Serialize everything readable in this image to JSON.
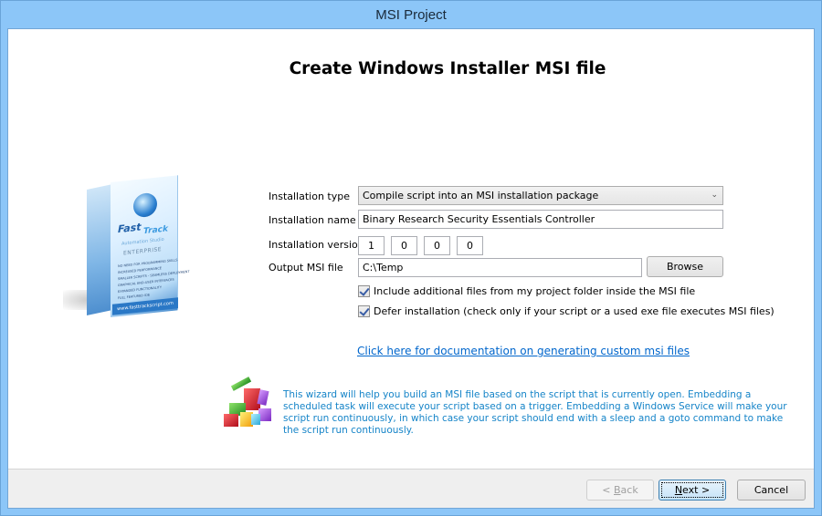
{
  "window": {
    "title": "MSI Project"
  },
  "heading": "Create Windows Installer MSI file",
  "product_box": {
    "brand": "Fast",
    "brand2": "Track",
    "subtitle": "Automation Studio",
    "edition": "ENTERPRISE",
    "spine": "FastTrack",
    "bullets": [
      "NO NEED FOR PROGRAMMING SKILLS",
      "INCREASED PERFORMANCE",
      "SMALLER SCRIPTS - SEAMLESS DEPLOYMENT",
      "GRAPHICAL END-USER INTERFACES",
      "EXPANDED FUNCTIONALITY",
      "FULL FEATURED IDE"
    ],
    "url": "www.fasttrackscript.com"
  },
  "form": {
    "installation_type": {
      "label": "Installation type",
      "value": "Compile script into an MSI installation package"
    },
    "installation_name": {
      "label": "Installation name",
      "value": "Binary Research Security Essentials Controller"
    },
    "installation_version": {
      "label": "Installation version",
      "parts": [
        "1",
        "0",
        "0",
        "0"
      ]
    },
    "output_msi_file": {
      "label": "Output MSI file",
      "value": "C:\\Temp",
      "browse_label": "Browse"
    },
    "include_files": {
      "label": "Include additional files from my project folder inside the MSI file",
      "checked": true
    },
    "defer_installation": {
      "label": "Defer installation (check only if your script or a used exe file executes MSI files)",
      "checked": true
    }
  },
  "doc_link": "Click here for documentation on generating custom msi files",
  "info_text": "This wizard will help you build an MSI file based on the script that is currently open. Embedding a scheduled task will execute your script based on a trigger. Embedding a Windows Service will make your script run continuously, in which case your script should end with a sleep and a goto command to make the script run continuously.",
  "buttons": {
    "back": {
      "prefix": "< ",
      "accel": "B",
      "rest": "ack",
      "enabled": false
    },
    "next": {
      "accel": "N",
      "rest": "ext >",
      "enabled": true
    },
    "cancel": {
      "label": "Cancel"
    }
  },
  "colors": {
    "frame": "#8cc6f8",
    "link": "#0066cc",
    "info_text": "#1584c8",
    "button_bar": "#efefef"
  }
}
